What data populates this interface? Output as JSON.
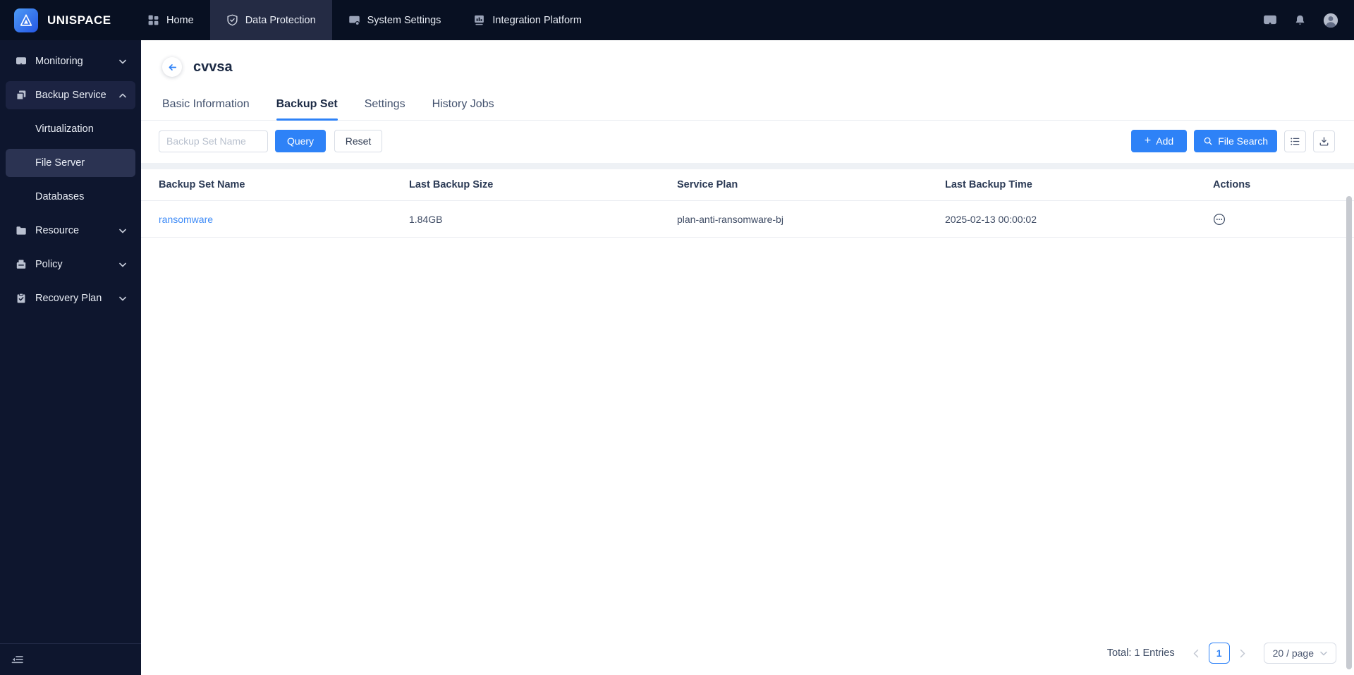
{
  "brand": {
    "name": "UNISPACE"
  },
  "topnav": {
    "items": [
      {
        "label": "Home"
      },
      {
        "label": "Data Protection"
      },
      {
        "label": "System Settings"
      },
      {
        "label": "Integration Platform"
      }
    ]
  },
  "sidebar": {
    "items": [
      {
        "label": "Monitoring"
      },
      {
        "label": "Backup Service"
      },
      {
        "label": "Virtualization"
      },
      {
        "label": "File Server"
      },
      {
        "label": "Databases"
      },
      {
        "label": "Resource"
      },
      {
        "label": "Policy"
      },
      {
        "label": "Recovery Plan"
      }
    ]
  },
  "page": {
    "title": "cvvsa",
    "tabs": [
      {
        "label": "Basic Information"
      },
      {
        "label": "Backup Set"
      },
      {
        "label": "Settings"
      },
      {
        "label": "History Jobs"
      }
    ]
  },
  "toolbar": {
    "search_placeholder": "Backup Set Name",
    "query_label": "Query",
    "reset_label": "Reset",
    "add_label": "Add",
    "file_search_label": "File Search"
  },
  "icons": {
    "plus": "+"
  },
  "table": {
    "columns": [
      "Backup Set Name",
      "Last Backup Size",
      "Service Plan",
      "Last Backup Time",
      "Actions"
    ],
    "rows": [
      {
        "name": "ransomware",
        "size": "1.84GB",
        "plan": "plan-anti-ransomware-bj",
        "time": "2025-02-13 00:00:02"
      }
    ]
  },
  "pagination": {
    "total_label": "Total: 1 Entries",
    "current_page": "1",
    "page_size": "20 / page"
  },
  "colors": {
    "accent": "#2e82f7",
    "link": "#3e8bf7",
    "nav_bg": "#081022",
    "sidebar_bg": "#0e162e"
  }
}
